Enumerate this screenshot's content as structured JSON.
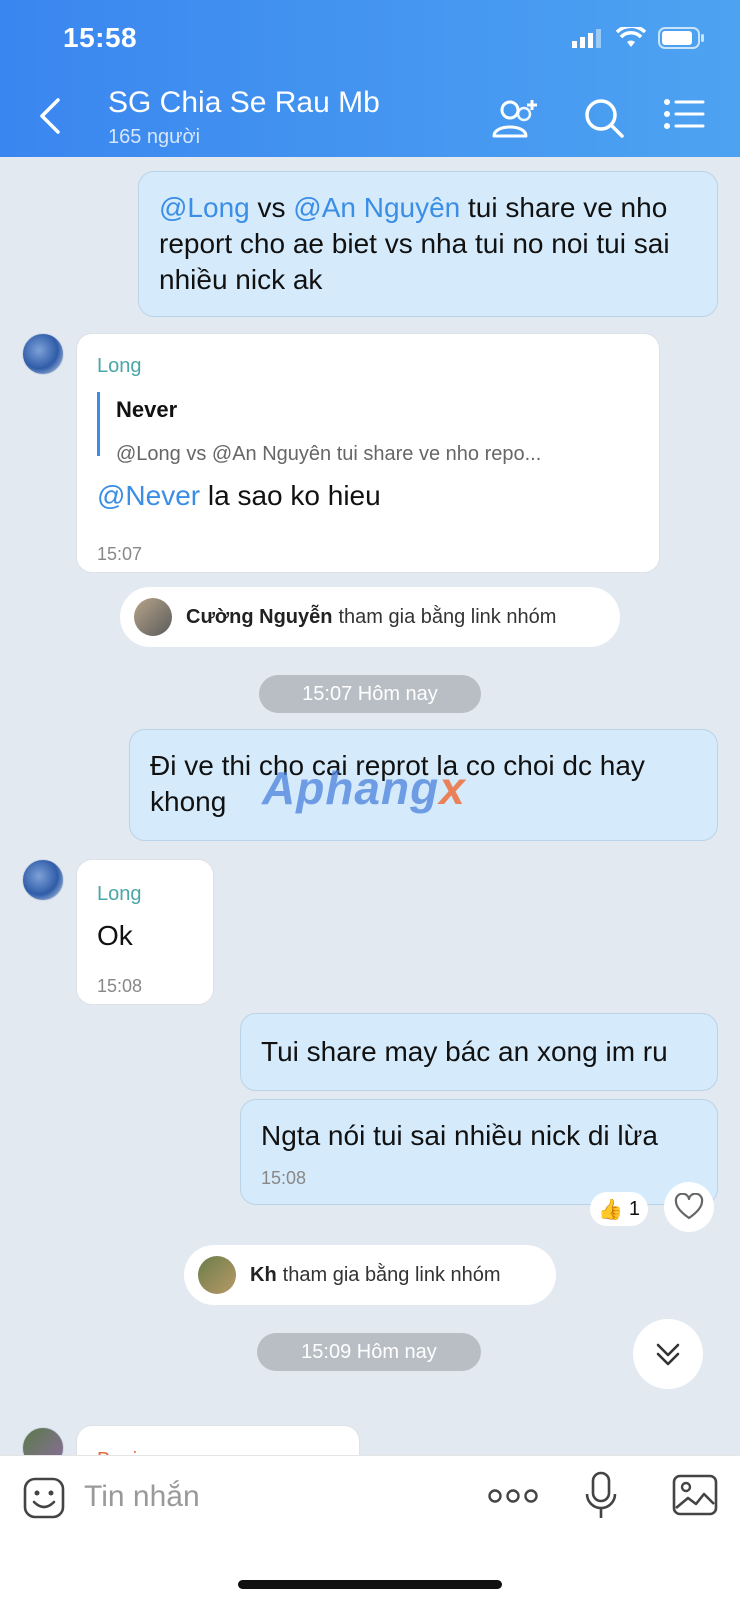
{
  "status_bar": {
    "time": "15:58"
  },
  "header": {
    "title": "SG Chia Se Rau Mb",
    "subtitle": "165 người"
  },
  "messages": {
    "m1": {
      "mention1": "@Long",
      "text1": " vs ",
      "mention2": "@An Nguyên",
      "text2": " tui share ve nho report cho ae biet vs nha tui no noi tui sai nhiều nick ak"
    },
    "m2": {
      "sender": "Long",
      "quote_name": "Never",
      "quote_text": "@Long  vs @An Nguyên tui share ve nho repo...",
      "mention": "@Never",
      "text": " la sao ko hieu",
      "time": "15:07"
    },
    "sys1": {
      "name": "Cường Nguyễn",
      "text": "tham gia bằng link nhóm"
    },
    "date1": "15:07 Hôm nay",
    "m3": {
      "text": "Đi ve thi cho cai reprot la co choi dc hay khong"
    },
    "m4": {
      "sender": "Long",
      "text": "Ok",
      "time": "15:08"
    },
    "m5": {
      "text": "Tui share may bác an xong im ru"
    },
    "m6": {
      "text": "Ngta nói tui sai nhiều nick di lừa",
      "time": "15:08"
    },
    "reaction": {
      "emoji": "👍",
      "count": "1"
    },
    "sys2": {
      "name": "Kh",
      "text": "tham gia bằng link nhóm"
    },
    "date2": "15:09 Hôm nay",
    "m7": {
      "sender": "Beginn"
    }
  },
  "watermark": {
    "main": "Aphang",
    "accent": "x"
  },
  "input": {
    "placeholder": "Tin nhắn"
  },
  "icons": [
    "back-icon",
    "add-member-icon",
    "search-icon",
    "menu-icon",
    "sticker-icon",
    "more-icon",
    "mic-icon",
    "image-icon",
    "heart-icon",
    "chevron-down-icon",
    "signal-icon",
    "wifi-icon",
    "battery-icon"
  ]
}
